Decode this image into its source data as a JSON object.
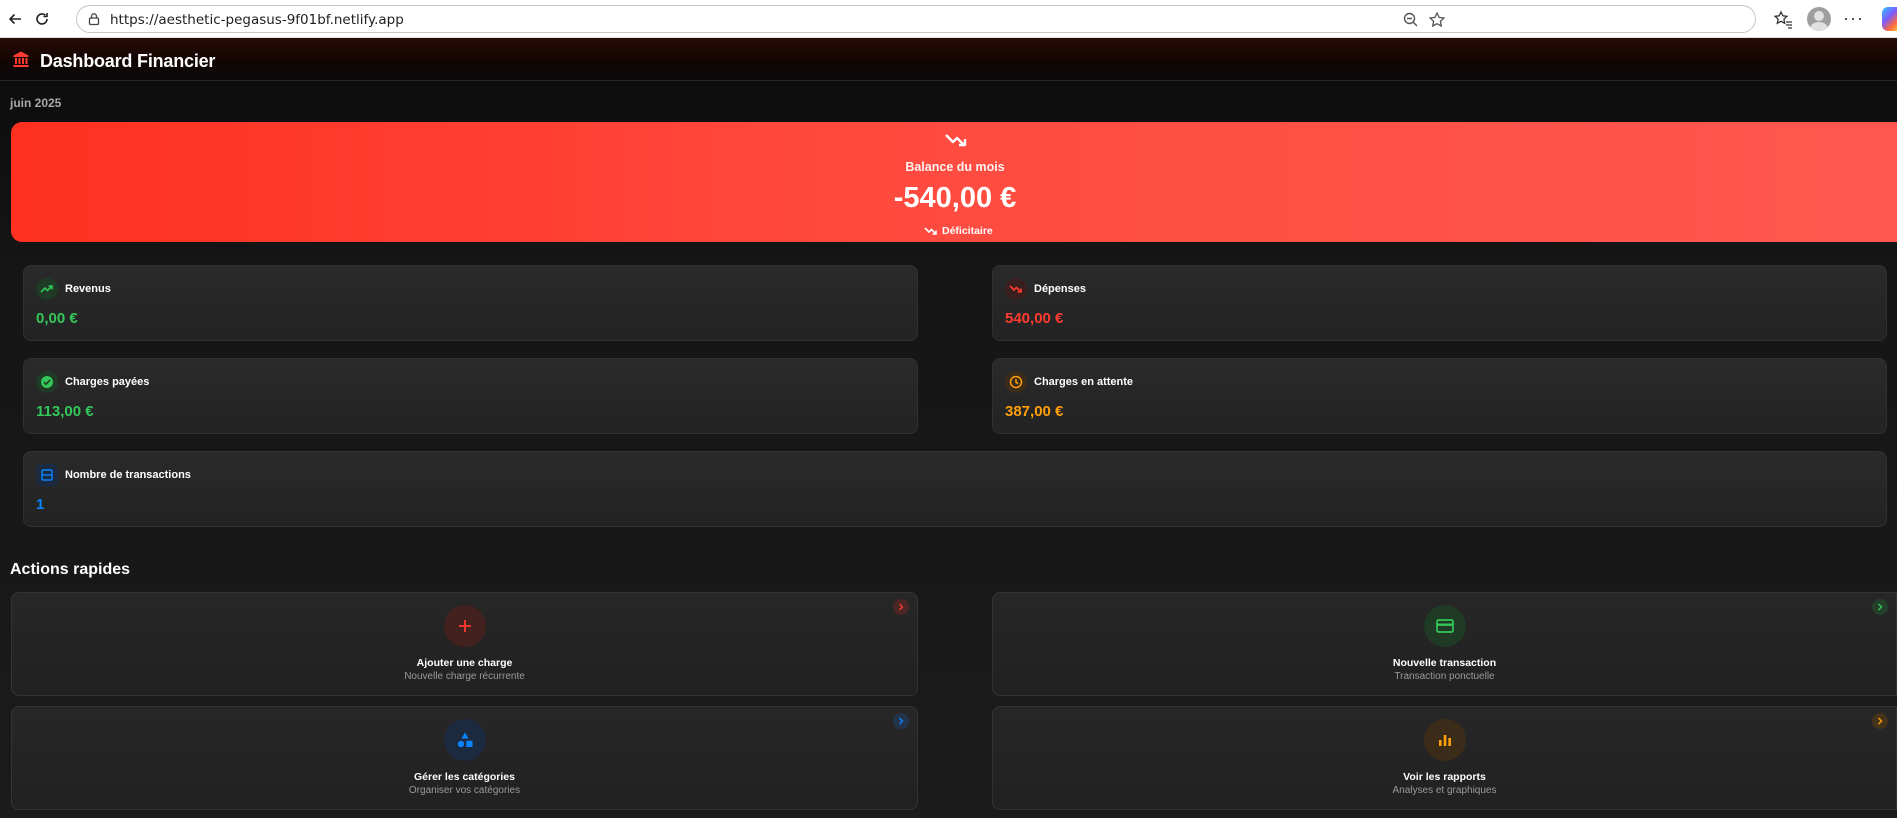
{
  "browser": {
    "url": "https://aesthetic-pegasus-9f01bf.netlify.app"
  },
  "app": {
    "title": "Dashboard Financier"
  },
  "period": "juin 2025",
  "balance": {
    "label": "Balance du mois",
    "value": "-540,00 €",
    "status": "Déficitaire"
  },
  "stats": {
    "revenus": {
      "label": "Revenus",
      "value": "0,00 €",
      "color": "#34c759"
    },
    "depenses": {
      "label": "Dépenses",
      "value": "540,00 €",
      "color": "#ff3b30"
    },
    "charges_payees": {
      "label": "Charges payées",
      "value": "113,00 €",
      "color": "#34c759"
    },
    "charges_attente": {
      "label": "Charges en attente",
      "value": "387,00 €",
      "color": "#ff9f0a"
    },
    "transactions": {
      "label": "Nombre de transactions",
      "value": "1",
      "color": "#0a84ff"
    }
  },
  "quick_actions": {
    "title": "Actions rapides",
    "items": [
      {
        "title": "Ajouter une charge",
        "subtitle": "Nouvelle charge récurrente",
        "icon": "plus-icon",
        "color": "#ff3b30"
      },
      {
        "title": "Nouvelle transaction",
        "subtitle": "Transaction ponctuelle",
        "icon": "card-icon",
        "color": "#34c759"
      },
      {
        "title": "Gérer les catégories",
        "subtitle": "Organiser vos catégories",
        "icon": "shapes-icon",
        "color": "#0a84ff"
      },
      {
        "title": "Voir les rapports",
        "subtitle": "Analyses et graphiques",
        "icon": "bar-chart-icon",
        "color": "#ff9f0a"
      }
    ]
  }
}
